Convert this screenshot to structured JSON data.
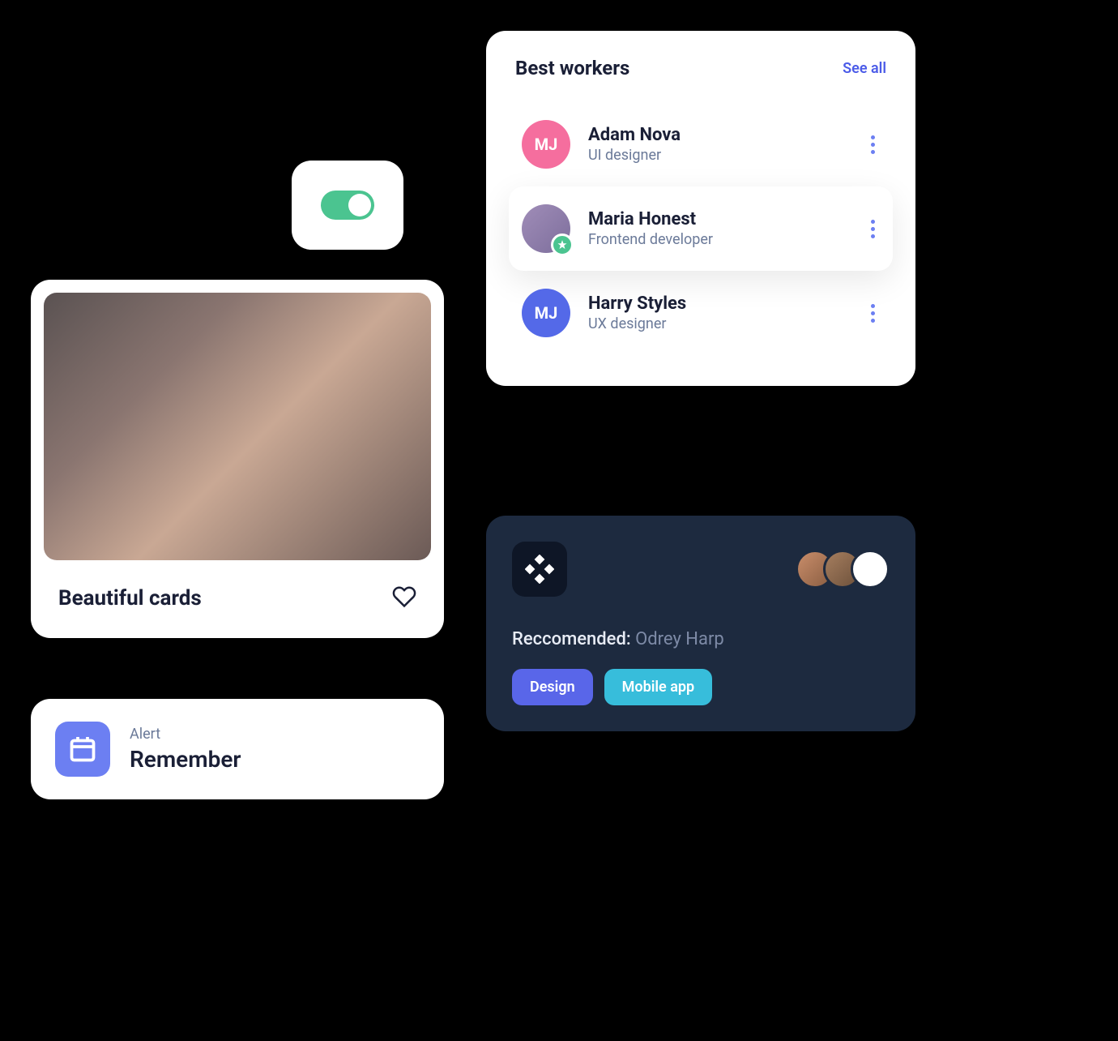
{
  "toggle": {
    "on": true
  },
  "image_card": {
    "title": "Beautiful cards"
  },
  "alert": {
    "label": "Alert",
    "title": "Remember"
  },
  "workers": {
    "title": "Best workers",
    "see_all": "See all",
    "items": [
      {
        "initials": "MJ",
        "name": "Adam Nova",
        "role": "UI designer",
        "avatar_type": "pink",
        "starred": false,
        "selected": false
      },
      {
        "initials": "",
        "name": "Maria Honest",
        "role": "Frontend developer",
        "avatar_type": "photo",
        "starred": true,
        "selected": true
      },
      {
        "initials": "MJ",
        "name": "Harry Styles",
        "role": "UX designer",
        "avatar_type": "blue",
        "starred": false,
        "selected": false
      }
    ]
  },
  "recommended": {
    "label": "Reccomended:",
    "name": "Odrey Harp",
    "tags": [
      {
        "label": "Design",
        "color": "purple"
      },
      {
        "label": "Mobile app",
        "color": "teal"
      }
    ]
  }
}
